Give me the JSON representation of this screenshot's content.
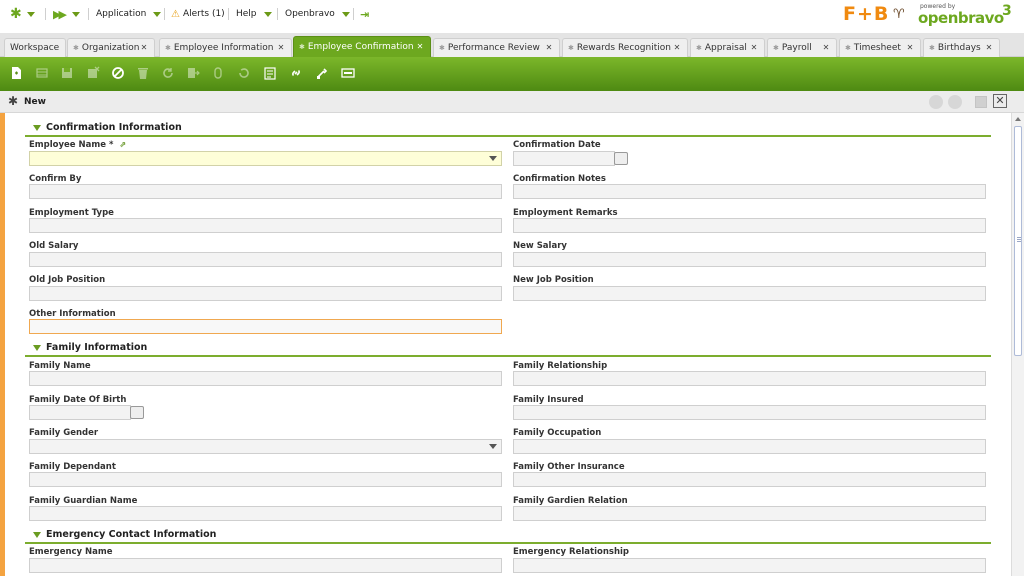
{
  "topmenu": {
    "application": "Application",
    "alerts": "Alerts (1)",
    "help": "Help",
    "user": "Openbravo"
  },
  "brand": {
    "fnb": "F+B",
    "powered_by": "powered by",
    "openbravo": "openbravo",
    "version": "3",
    "accent": "#6da81f",
    "brand_orange": "#f08a10"
  },
  "tabs": [
    {
      "label": "Workspace",
      "closable": false
    },
    {
      "label": "Organization",
      "closable": true
    },
    {
      "label": "Employee Information",
      "closable": true
    },
    {
      "label": "Employee Confirmation",
      "closable": true,
      "active": true
    },
    {
      "label": "Performance Review",
      "closable": true
    },
    {
      "label": "Rewards Recognition",
      "closable": true
    },
    {
      "label": "Appraisal",
      "closable": true
    },
    {
      "label": "Payroll",
      "closable": true
    },
    {
      "label": "Timesheet",
      "closable": true
    },
    {
      "label": "Birthdays",
      "closable": true
    }
  ],
  "toolbar": {
    "buttons": [
      "new-document-icon",
      "grid-icon",
      "save-icon",
      "save-close-icon",
      "cancel-icon",
      "delete-icon",
      "refresh-icon",
      "export-icon",
      "attachment-icon",
      "undo-icon",
      "checklist-icon",
      "link-icon",
      "tools-icon",
      "form-view-icon"
    ]
  },
  "status": {
    "title": "New"
  },
  "sections": {
    "confirmation": "Confirmation Information",
    "family": "Family Information",
    "emergency": "Emergency Contact Information"
  },
  "fields": {
    "employee_name": "Employee Name",
    "required_mark": "*",
    "confirmation_date": "Confirmation Date",
    "confirm_by": "Confirm By",
    "confirmation_notes": "Confirmation Notes",
    "employment_type": "Employment Type",
    "employment_remarks": "Employment Remarks",
    "old_salary": "Old Salary",
    "new_salary": "New Salary",
    "old_job_position": "Old Job Position",
    "new_job_position": "New Job Position",
    "other_information": "Other Information",
    "family_name": "Family Name",
    "family_relationship": "Family Relationship",
    "family_dob": "Family Date Of Birth",
    "family_insured": "Family Insured",
    "family_gender": "Family Gender",
    "family_occupation": "Family Occupation",
    "family_dependant": "Family Dependant",
    "family_other_insurance": "Family Other Insurance",
    "family_guardian_name": "Family Guardian Name",
    "family_gardien_relation": "Family Gardien Relation",
    "emergency_name": "Emergency Name",
    "emergency_relationship": "Emergency Relationship"
  }
}
